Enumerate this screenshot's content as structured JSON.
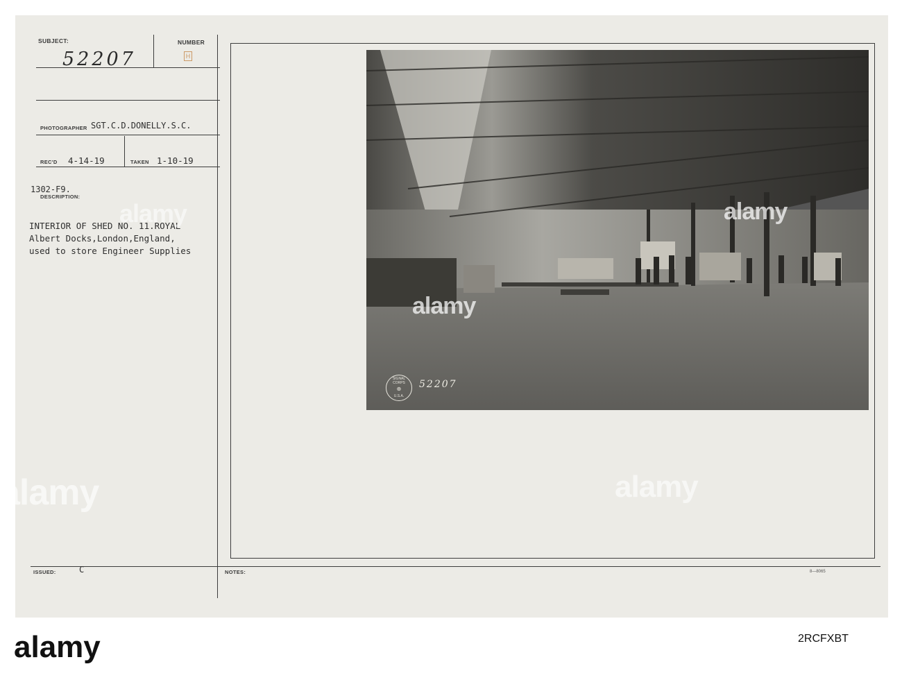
{
  "card": {
    "subject_label": "SUBJECT:",
    "subject_number": "52207",
    "number_label": "NUMBER",
    "number_value": "H",
    "photographer_label": "PHOTOGRAPHER",
    "photographer_value": "SGT.C.D.DONELLY.S.C.",
    "recd_label": "REC'D",
    "recd_value": "4-14-19",
    "taken_label": "TAKEN",
    "taken_value": "1-10-19",
    "file_code": "1302-F9.",
    "description_label": "DESCRIPTION:",
    "description_lines": [
      "INTERIOR OF SHED NO. 11.ROYAL",
      "Albert Docks,London,England,",
      "used to store Engineer Supplies"
    ],
    "issued_label": "ISSUED:",
    "issued_value": "C",
    "notes_label": "NOTES:",
    "form_code": "8—8065"
  },
  "photo": {
    "stamp_text": "SIGNAL CORPS",
    "stamp_usa": "U.S.A.",
    "photo_number": "52207"
  },
  "watermark": {
    "brand": "alamy",
    "image_id": "2RCFXBT",
    "photo_brand_overlays": [
      "alamy",
      "alamy",
      "alamy"
    ]
  }
}
